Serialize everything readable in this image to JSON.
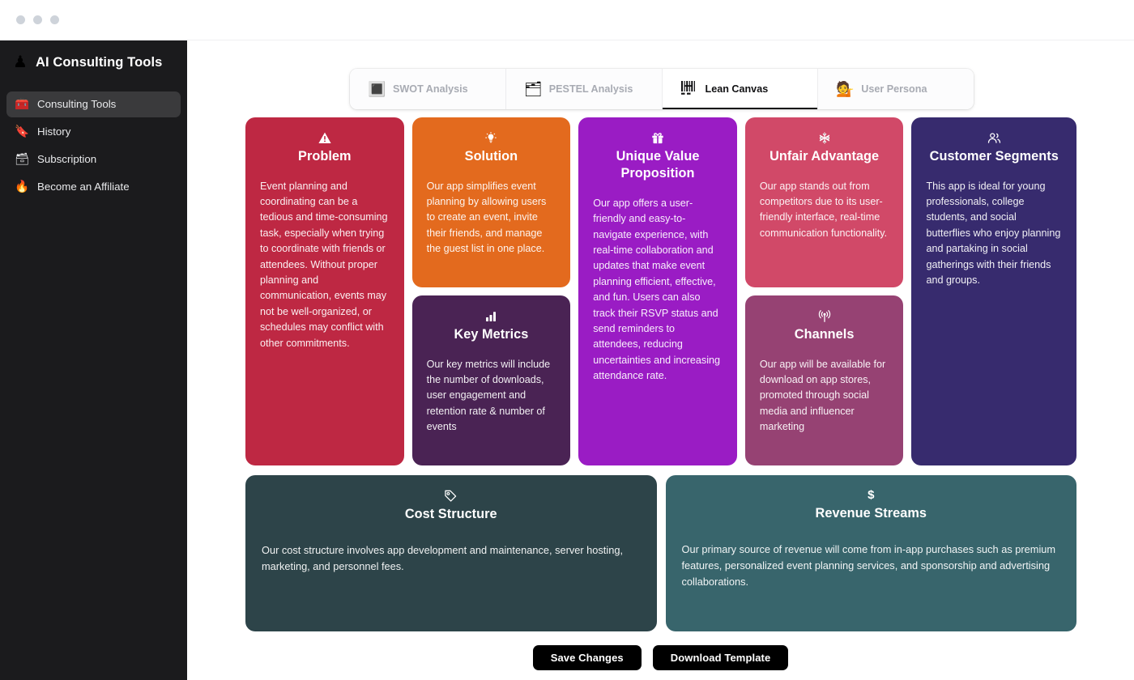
{
  "window": {
    "traffic_lights": [
      "close",
      "minimize",
      "maximize"
    ]
  },
  "sidebar": {
    "brand": {
      "icon": "chess-pawn-icon",
      "glyph": "♟",
      "title": "AI Consulting Tools"
    },
    "items": [
      {
        "label": "Consulting Tools",
        "icon": "toolbox-icon",
        "glyph": "🧰",
        "active": true
      },
      {
        "label": "History",
        "icon": "bookmark-icon",
        "glyph": "🔖",
        "active": false
      },
      {
        "label": "Subscription",
        "icon": "card-index-icon",
        "glyph": "🗃",
        "active": false
      },
      {
        "label": "Become an Affiliate",
        "icon": "fire-icon",
        "glyph": "🔥",
        "active": false
      }
    ]
  },
  "tabs": [
    {
      "label": "SWOT Analysis",
      "icon": "swot-grid-icon",
      "glyph": "🔳",
      "active": false
    },
    {
      "label": "PESTEL Analysis",
      "icon": "document-chart-icon",
      "glyph": "🗂",
      "active": false
    },
    {
      "label": "Lean Canvas",
      "icon": "barcode-icon",
      "glyph": "🏦",
      "active": true
    },
    {
      "label": "User Persona",
      "icon": "person-icon",
      "glyph": "💁",
      "active": false
    }
  ],
  "canvas": {
    "cards": {
      "problem": {
        "title": "Problem",
        "icon": "warning-triangle-icon",
        "color": "#BE2843",
        "body": "Event planning and coordinating can be a tedious and time-consuming task, especially when trying to coordinate with friends or attendees. Without proper planning and communication, events may not be well-organized, or schedules may conflict with other commitments."
      },
      "solution": {
        "title": "Solution",
        "icon": "lightbulb-icon",
        "color": "#E36A1E",
        "body": "Our app simplifies event planning by allowing users to create an event, invite their friends, and manage the guest list in one place."
      },
      "key_metrics": {
        "title": "Key Metrics",
        "icon": "bar-chart-icon",
        "color": "#4A2354",
        "body": "Our key metrics will include the number of downloads, user engagement and retention rate & number of events"
      },
      "unique_value_proposition": {
        "title": "Unique Value Proposition",
        "icon": "gift-icon",
        "color": "#9A1CC4",
        "body": "Our app offers a user-friendly and easy-to-navigate experience, with real-time collaboration and updates that make event planning efficient, effective, and fun. Users can also track their RSVP status and send reminders to attendees, reducing uncertainties and increasing attendance rate."
      },
      "unfair_advantage": {
        "title": "Unfair Advantage",
        "icon": "snowflake-icon",
        "color": "#D14968",
        "body": "Our app stands out from competitors due to its user-friendly interface, real-time communication functionality."
      },
      "channels": {
        "title": "Channels",
        "icon": "broadcast-antenna-icon",
        "color": "#964273",
        "body": "Our app will be available for download on app stores, promoted through social media and influencer marketing"
      },
      "customer_segments": {
        "title": "Customer Segments",
        "icon": "users-icon",
        "color": "#372B6E",
        "body": "This app is ideal for young professionals, college students, and social butterflies who enjoy planning and partaking in social gatherings with their friends and groups."
      },
      "cost_structure": {
        "title": "Cost Structure",
        "icon": "tag-icon",
        "color": "#2D4449",
        "body": "Our cost structure involves app development and maintenance, server hosting, marketing, and personnel fees."
      },
      "revenue_streams": {
        "title": "Revenue Streams",
        "icon": "dollar-icon",
        "glyph": "$",
        "color": "#38656C",
        "body": "Our primary source of revenue will come from in-app purchases such as premium features, personalized event planning services, and sponsorship and advertising collaborations."
      }
    }
  },
  "actions": {
    "save_label": "Save Changes",
    "download_label": "Download Template"
  }
}
